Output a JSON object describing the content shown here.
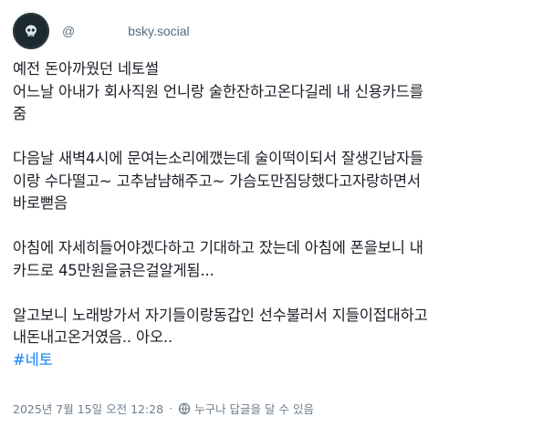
{
  "author": {
    "at": "@",
    "domain": "bsky.social",
    "avatar_icon": "skull-avatar"
  },
  "post": {
    "lines": [
      "예전 돈아까웠던 네토썰",
      "어느날 아내가 회사직원 언니랑 술한잔하고온다길레 내 신용카드를",
      "줌",
      "",
      "다음날 새벽4시에 문여는소리에깼는데 술이떡이되서 잘생긴남자들",
      "이랑 수다떨고~ 고추냠냠해주고~ 가슴도만짐당했다고자랑하면서",
      "바로뻗음",
      "",
      "아침에 자세히들어야겠다하고 기대하고 잤는데 아침에 폰을보니 내",
      "카드로 45만원을긁은걸알게됨...",
      "",
      "알고보니 노래방가서 자기들이랑동갑인 선수불러서 지들이접대하고",
      "내돈내고온거였음.. 아오.."
    ],
    "hashtag": "#네토"
  },
  "footer": {
    "timestamp": "2025년 7월 15일 오전 12:28",
    "separator": "·",
    "reply_setting": "누구나 답글을 달 수 있음",
    "reply_icon": "everyone-reply-icon"
  },
  "colors": {
    "text": "#1a1f26",
    "muted": "#6f7f8f",
    "hashtag": "#1083fe"
  }
}
